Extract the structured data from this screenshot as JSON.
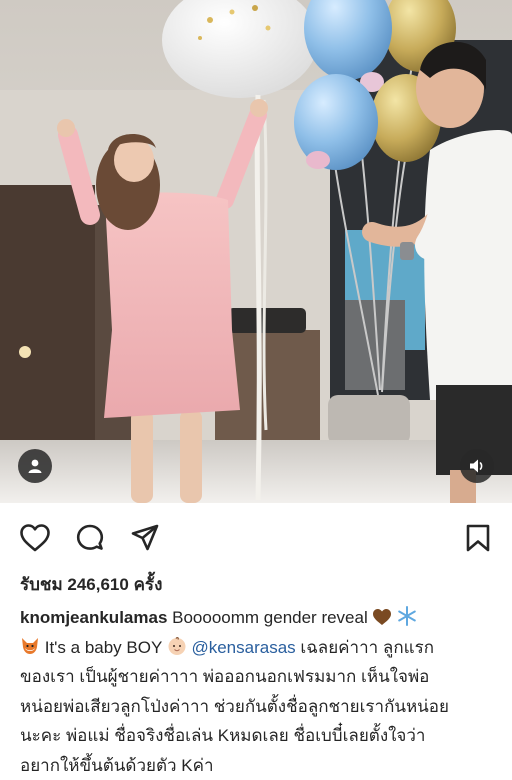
{
  "post": {
    "views_text": "รับชม 246,610 ครั้ง",
    "caption": {
      "username": "knomjeankulamas",
      "line1_text": " Booooomm gender reveal",
      "line2_text": " It's a baby BOY",
      "mention": "@kensarasas",
      "line2_rest": " เฉลยค่าาา ลูกแรก",
      "line3": "ของเรา เป็นผู้ชายค่าาาา พ่อออกนอกเฟรมมาก เห็นใจพ่อ",
      "line4": "หน่อยพ่อเสียวลูกโป่งค่าาา ช่วยกันตั้งชื่อลูกชายเรากันหน่อย",
      "line5": "นะคะ พ่อแม่ ชื่อจริงชื่อเล่น Kหมดเลย ชื่อเบบี๋เลยตั้งใจว่า",
      "line6": "อยากให้ขึ้นต้นด้วยตัว Kค่า"
    }
  },
  "icons": {
    "like": "heart-outline-icon",
    "comment": "comment-bubble-icon",
    "share": "paper-plane-icon",
    "save": "bookmark-icon",
    "tags": "person-tag-icon",
    "sound": "speaker-icon"
  }
}
